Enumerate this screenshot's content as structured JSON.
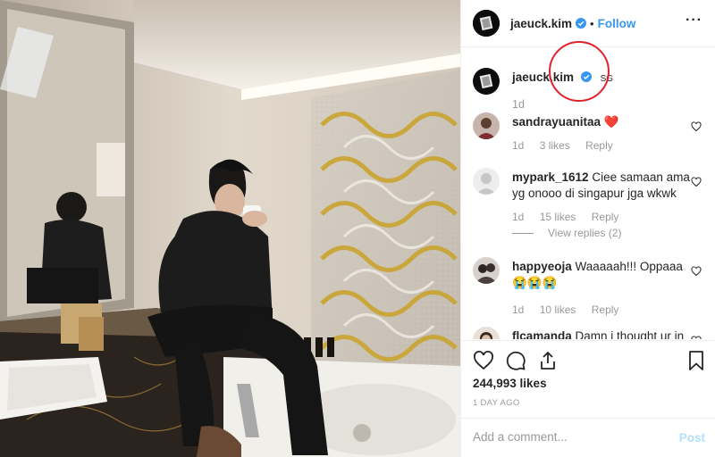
{
  "header": {
    "username": "jaeuck.kim",
    "separator": "•",
    "follow_label": "Follow",
    "more_label": "···"
  },
  "caption": {
    "username": "jaeuck.kim",
    "text": "SG",
    "time": "1d"
  },
  "comments": [
    {
      "username": "sandrayuanitaa",
      "text": "❤️",
      "time": "1d",
      "likes": "3 likes",
      "reply": "Reply"
    },
    {
      "username": "mypark_1612",
      "text": "Ciee samaan ama yg onooo di singapur jga wkwk",
      "time": "1d",
      "likes": "15 likes",
      "reply": "Reply",
      "view_replies": "View replies (2)"
    },
    {
      "username": "happyeoja",
      "text": "Waaaaah!!! Oppaaa 😭😭😭",
      "time": "1d",
      "likes": "10 likes",
      "reply": "Reply"
    },
    {
      "username": "flcamanda",
      "text": "Damn i thought ur in",
      "time": "",
      "likes": "",
      "reply": ""
    }
  ],
  "stats": {
    "likes": "244,993 likes",
    "ago": "1 DAY AGO"
  },
  "add_comment": {
    "placeholder": "Add a comment...",
    "post_label": "Post"
  },
  "icons": [
    "heart-icon",
    "comment-icon",
    "share-icon",
    "bookmark-icon",
    "verified-badge-icon",
    "more-icon"
  ],
  "colors": {
    "accent": "#3897f0",
    "post_disabled": "#b2dffc",
    "annotation_circle": "#e3202a",
    "heart": "#ed4956"
  }
}
